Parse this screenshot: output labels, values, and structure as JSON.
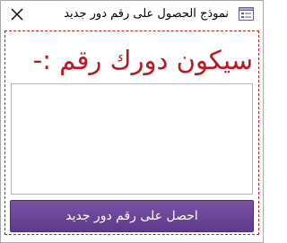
{
  "window": {
    "title": "نموذج الحصول على رقم دور جديد",
    "close_icon": "close-icon",
    "form_icon": "form-icon"
  },
  "form": {
    "heading": "سيكون دورك رقم :-",
    "result_value": "",
    "button_label": "احصل على رقم دور جديد"
  },
  "colors": {
    "heading": "#c0141e",
    "form_border": "#c41e2a",
    "button": "#6a4596"
  }
}
